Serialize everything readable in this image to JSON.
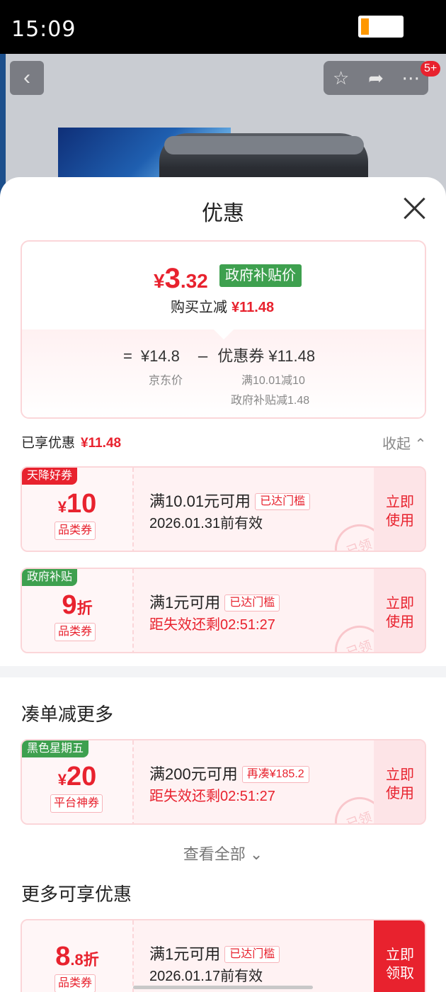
{
  "status_bar": {
    "time": "15:09",
    "battery_percent": 0.17
  },
  "nav": {
    "back_icon": "chevron-left-icon",
    "notification_badge": "5+"
  },
  "sheet": {
    "title": "优惠"
  },
  "summary": {
    "currency": "¥",
    "final_int": "3",
    "final_dec": ".32",
    "gov_tag": "政府补贴价",
    "buy_reduce_label": "购买立减",
    "buy_reduce_amount": "¥11.48",
    "equals": "=",
    "jd_price": "¥14.8",
    "minus": "–",
    "coupon_total": "优惠券 ¥11.48",
    "jd_price_label": "京东价",
    "coupon_detail_1": "满10.01减10",
    "coupon_detail_2": "政府补贴减1.48"
  },
  "enjoyed": {
    "label": "已享优惠",
    "amount": "¥11.48",
    "collapse": "收起"
  },
  "coupons": [
    {
      "tag": "天降好券",
      "yen": "¥",
      "value": "10",
      "unit": "",
      "kind": "品类券",
      "condition": "满10.01元可用",
      "flag": "已达门槛",
      "sub": "2026.01.31前有效",
      "button": "立即使用",
      "stamp": "已领"
    },
    {
      "tag": "政府补贴",
      "yen": "",
      "value": "9",
      "unit": "折",
      "kind": "品类券",
      "condition": "满1元可用",
      "flag": "已达门槛",
      "sub": "距失效还剩02:51:27",
      "button": "立即使用",
      "stamp": "已领"
    }
  ],
  "more": {
    "title": "凑单减更多",
    "coupon": {
      "tag": "黑色星期五",
      "yen": "¥",
      "value": "20",
      "kind": "平台神券",
      "condition": "满200元可用",
      "flag": "再凑¥185.2",
      "sub": "距失效还剩02:51:27",
      "button": "立即使用",
      "stamp": "已领"
    },
    "view_all": "查看全部"
  },
  "extra": {
    "title": "更多可享优惠",
    "coupon": {
      "value": "8",
      "dec": ".8",
      "unit": "折",
      "kind": "品类券",
      "condition": "满1元可用",
      "flag": "已达门槛",
      "sub": "2026.01.17前有效",
      "button": "立即领取"
    }
  },
  "colors": {
    "accent": "#e8222e",
    "green": "#3ea04f",
    "pink_border": "#fbd6d9"
  }
}
